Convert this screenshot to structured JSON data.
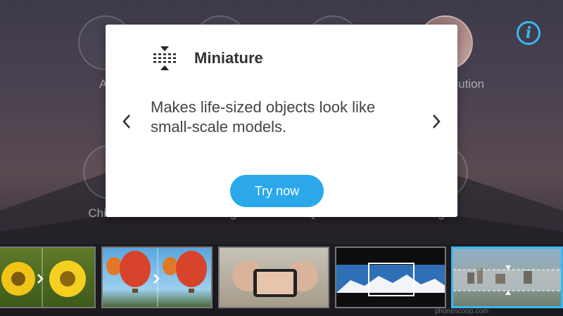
{
  "background_modes": {
    "top_row_labels": [
      "A",
      "",
      "",
      "olution"
    ],
    "bottom_row_labels": [
      "Children",
      "Low Light",
      "QR code",
      "Night"
    ]
  },
  "popup": {
    "title": "Miniature",
    "icon": "miniature-tilt-shift-icon",
    "description": "Makes life-sized objects look like small-scale models.",
    "button_label": "Try now",
    "prev_icon": "chevron-left-icon",
    "next_icon": "chevron-right-icon"
  },
  "info_icon": {
    "glyph": "i",
    "color": "#39b7f0"
  },
  "thumbnails": [
    {
      "name": "sunflowers-thumbnail",
      "selected": false
    },
    {
      "name": "hot-air-balloons-thumbnail",
      "selected": false
    },
    {
      "name": "selfie-thumbnail",
      "selected": false
    },
    {
      "name": "mountain-panorama-thumbnail",
      "selected": false
    },
    {
      "name": "miniature-city-thumbnail",
      "selected": true
    }
  ],
  "colors": {
    "accent": "#2aa8ea"
  },
  "watermark": "phonescoop.com"
}
